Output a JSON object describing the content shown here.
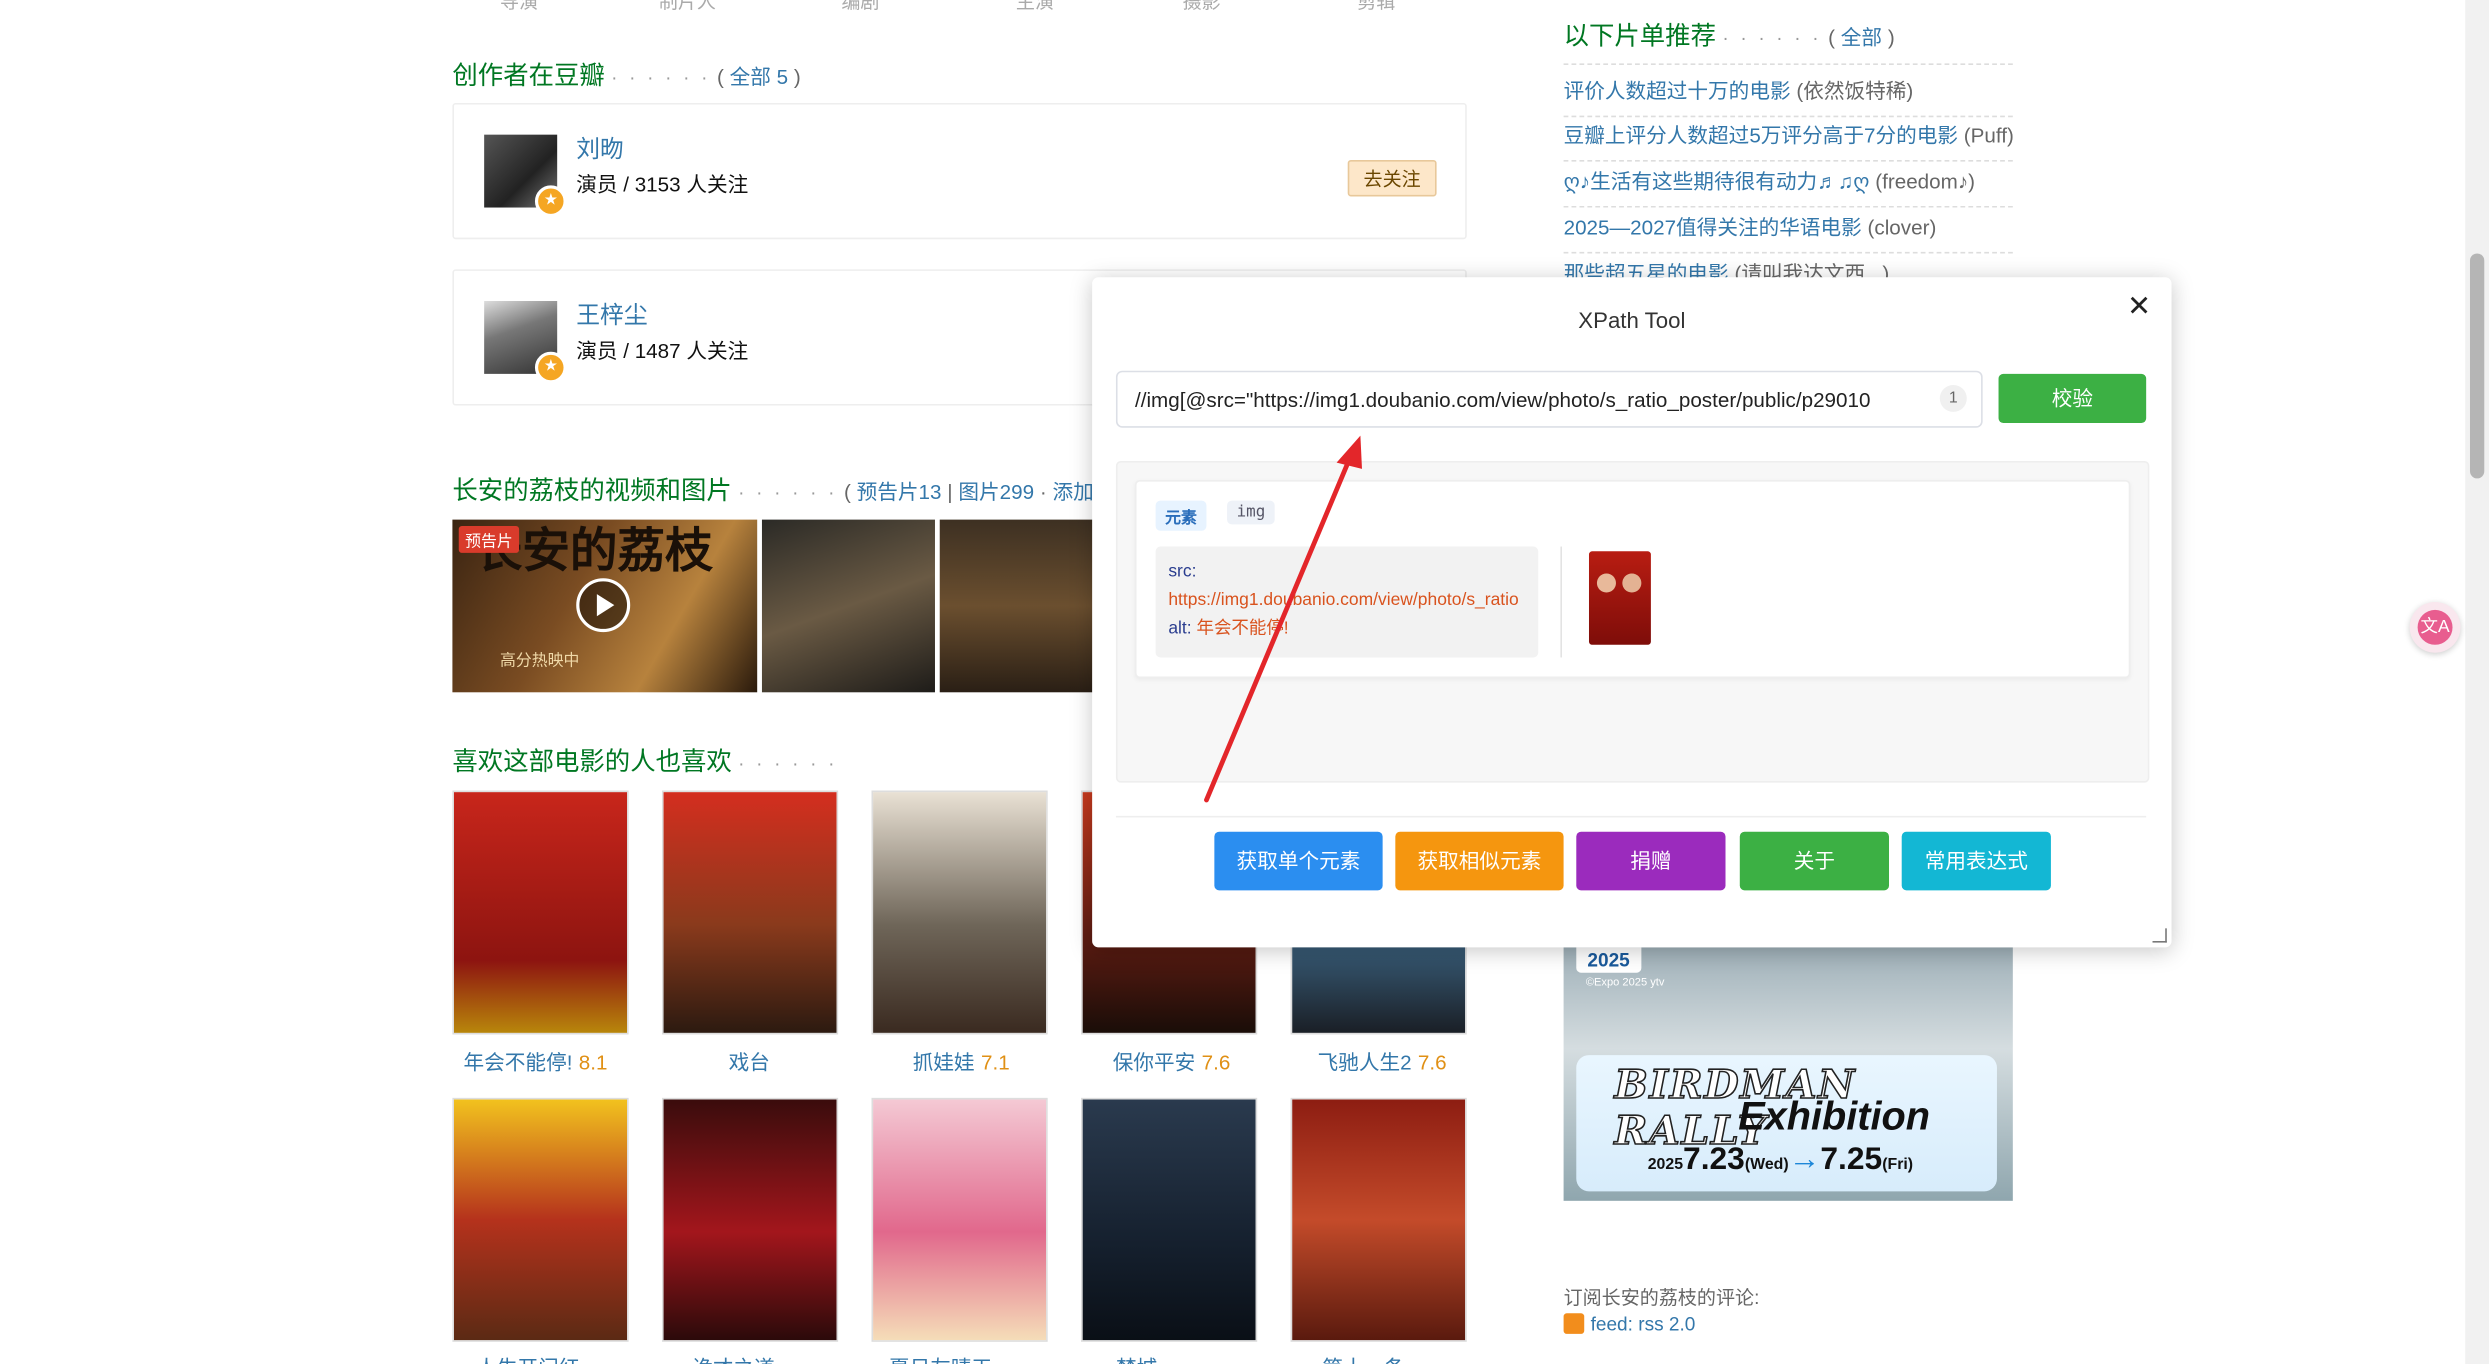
{
  "topnav": [
    "导演",
    "制片人",
    "编剧",
    "主演",
    "摄影",
    "剪辑"
  ],
  "creators": {
    "heading": "创作者在豆瓣",
    "all_link": "全部 5",
    "items": [
      {
        "name": "刘昒",
        "info": "演员 / 3153 人关注",
        "follow": "去关注"
      },
      {
        "name": "王梓尘",
        "info": "演员 / 1487 人关注"
      }
    ]
  },
  "media": {
    "heading": "长安的荔枝的视频和图片",
    "trailers_link": "预告片13",
    "sep": "|",
    "photos_link": "图片299",
    "add_link": "添加",
    "trailer_tag": "预告片",
    "poster_title": "长安的荔枝",
    "poster_sub": "高分热映中"
  },
  "also_like": {
    "heading": "喜欢这部电影的人也喜欢",
    "row1": [
      {
        "title": "年会不能停!",
        "score": "8.1"
      },
      {
        "title": "戏台",
        "score": ""
      },
      {
        "title": "抓娃娃",
        "score": "7.1"
      },
      {
        "title": "保你平安",
        "score": "7.6"
      },
      {
        "title": "飞驰人生2",
        "score": "7.6"
      }
    ],
    "row2_titles": [
      "人生开门红",
      "诡才之道",
      "夏日友晴天",
      "焚城",
      "第十一条"
    ]
  },
  "sidebar": {
    "heading": "以下片单推荐",
    "all_link": "全部",
    "lists": [
      {
        "title": "评价人数超过十万的电影",
        "author": "(依然饭特稀)"
      },
      {
        "title": "豆瓣上评分人数超过5万评分高于7分的电影",
        "author": "(Puff)"
      },
      {
        "title": "ღ♪生活有这些期待很有动力♬♫ღ",
        "author": "(freedom♪)"
      },
      {
        "title": "2025—2027值得关注的华语电影",
        "author": "(clover)"
      },
      {
        "title": "那些超五星的电影",
        "author": "(请叫我达文西...)"
      }
    ],
    "ad": {
      "year": "2025",
      "copyright": "©Expo 2025 ytv",
      "title1": "BIRDMAN RALLY",
      "title2": "Exhibition",
      "year_small": "2025",
      "date_start": "7.23",
      "day_start": "(Wed)",
      "arrow": "→",
      "date_end": "7.25",
      "day_end": "(Fri)"
    },
    "subscribe_label": "订阅长安的荔枝的评论:",
    "rss_label": "feed: rss 2.0"
  },
  "xpath_tool": {
    "title": "XPath Tool",
    "close": "✕",
    "query": "//img[@src=\"https://img1.doubanio.com/view/photo/s_ratio_poster/public/p29010",
    "match_count": "1",
    "check_button": "校验",
    "result": {
      "tag_element": "元素",
      "tag_name": "img",
      "src_key": "src:",
      "src_value": "https://img1.doubanio.com/view/photo/s_ratio",
      "alt_key": "alt:",
      "alt_value": "年会不能停!"
    },
    "buttons": {
      "get_single": "获取单个元素",
      "get_similar": "获取相似元素",
      "donate": "捐赠",
      "about": "关于",
      "common_expr": "常用表达式"
    }
  },
  "translate_icon_text": "文A",
  "colors": {
    "douban_green": "#007722",
    "link_blue": "#3377aa",
    "score_orange": "#e09015",
    "check_green": "#3cb044",
    "btn_blue": "#2b8ef0",
    "btn_orange": "#f5960f",
    "btn_purple": "#9b2bbd",
    "btn_cyan": "#13b7d4",
    "annotation_arrow": "#e3262a"
  }
}
